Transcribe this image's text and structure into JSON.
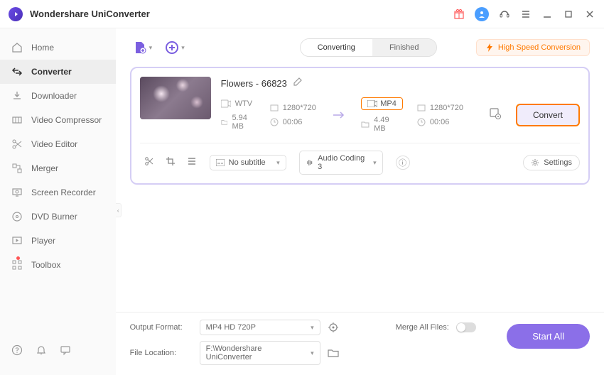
{
  "app": {
    "title": "Wondershare UniConverter"
  },
  "sidebar": {
    "items": [
      {
        "icon": "home",
        "label": "Home"
      },
      {
        "icon": "arrows",
        "label": "Converter",
        "active": true
      },
      {
        "icon": "download",
        "label": "Downloader"
      },
      {
        "icon": "compress",
        "label": "Video Compressor"
      },
      {
        "icon": "scissors",
        "label": "Video Editor"
      },
      {
        "icon": "merge",
        "label": "Merger"
      },
      {
        "icon": "record",
        "label": "Screen Recorder"
      },
      {
        "icon": "disc",
        "label": "DVD Burner"
      },
      {
        "icon": "play",
        "label": "Player"
      },
      {
        "icon": "grid",
        "label": "Toolbox"
      }
    ]
  },
  "tabs": {
    "converting": "Converting",
    "finished": "Finished"
  },
  "topbar": {
    "high_speed": "High Speed Conversion"
  },
  "file": {
    "name": "Flowers - 66823",
    "src_fmt": "WTV",
    "src_size": "5.94 MB",
    "src_res": "1280*720",
    "src_dur": "00:06",
    "dst_fmt": "MP4",
    "dst_size": "4.49 MB",
    "dst_res": "1280*720",
    "dst_dur": "00:06",
    "convert_btn": "Convert",
    "subtitle": "No subtitle",
    "audio": "Audio Coding 3",
    "settings": "Settings"
  },
  "footer": {
    "output_label": "Output Format:",
    "output_value": "MP4 HD 720P",
    "location_label": "File Location:",
    "location_value": "F:\\Wondershare UniConverter",
    "merge_label": "Merge All Files:",
    "start_all": "Start All"
  }
}
